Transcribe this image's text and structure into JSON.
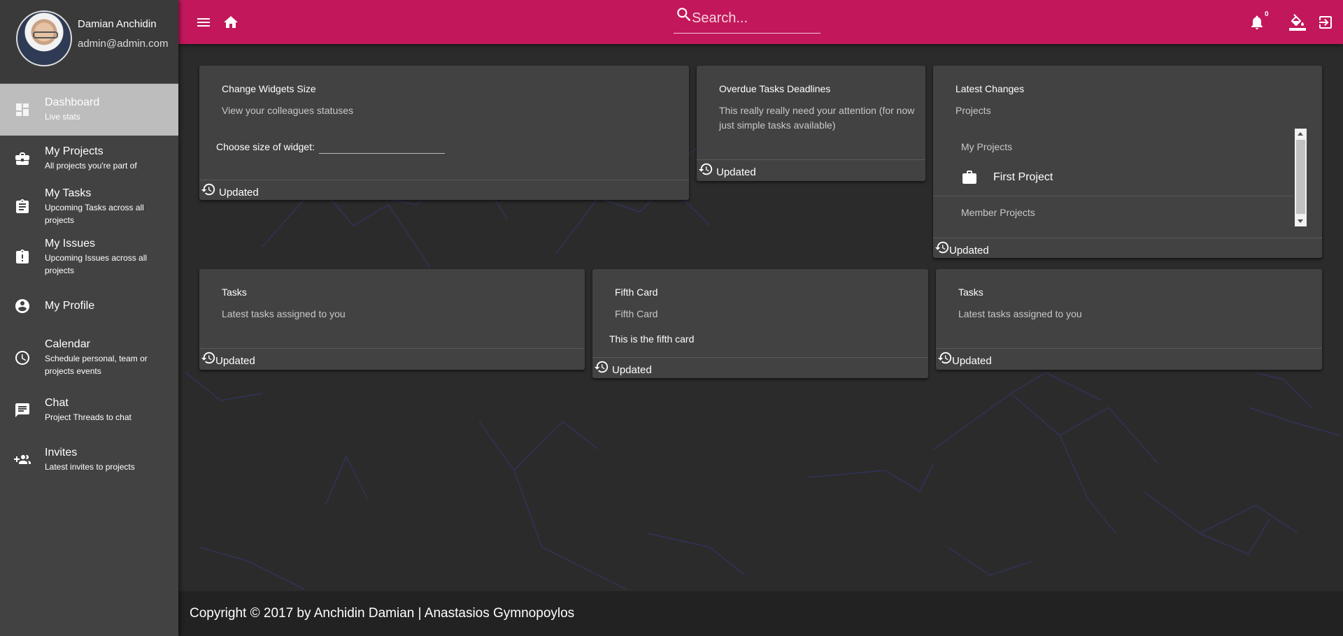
{
  "profile": {
    "name": "Damian Anchidin",
    "email": "admin@admin.com"
  },
  "sidebar": {
    "items": [
      {
        "title": "Dashboard",
        "sub": "Live stats",
        "icon": "dashboard-icon",
        "active": true
      },
      {
        "title": "My Projects",
        "sub": "All projects you're part of",
        "icon": "briefcase-icon"
      },
      {
        "title": "My Tasks",
        "sub": "Upcoming Tasks across all projects",
        "icon": "clipboard-icon"
      },
      {
        "title": "My Issues",
        "sub": "Upcoming Issues across all projects",
        "icon": "clipboard-alert-icon"
      },
      {
        "title": "My Profile",
        "sub": "",
        "icon": "account-circle-icon"
      },
      {
        "title": "Calendar",
        "sub": "Schedule personal, team or projects events",
        "icon": "clock-icon"
      },
      {
        "title": "Chat",
        "sub": "Project Threads to chat",
        "icon": "chat-icon"
      },
      {
        "title": "Invites",
        "sub": "Latest invites to projects",
        "icon": "group-add-icon"
      }
    ]
  },
  "topbar": {
    "search_placeholder": "Search...",
    "notification_count": "0",
    "brand_color": "#c2185b"
  },
  "cards": {
    "widgets": {
      "title": "Change Widgets Size",
      "sub": "View your colleagues statuses",
      "select_label": "Choose size of widget:",
      "footer": "Updated"
    },
    "overdue": {
      "title": "Overdue Tasks Deadlines",
      "sub": "This really really need your attention (for now just simple tasks available)",
      "footer": "Updated"
    },
    "latest": {
      "title": "Latest Changes",
      "sub": "Projects",
      "my_projects_label": "My Projects",
      "project_name": "First Project",
      "member_projects_label": "Member Projects",
      "footer": "Updated"
    },
    "tasks_left": {
      "title": "Tasks",
      "sub": "Latest tasks assigned to you",
      "footer": "Updated"
    },
    "fifth": {
      "title": "Fifth Card",
      "sub": "Fifth Card",
      "body": "This is the fifth card",
      "footer": "Updated"
    },
    "tasks_right": {
      "title": "Tasks",
      "sub": "Latest tasks assigned to you",
      "footer": "Updated"
    }
  },
  "footer": {
    "text": "Copyright © 2017 by Anchidin Damian | Anastasios Gymnopoylos"
  }
}
